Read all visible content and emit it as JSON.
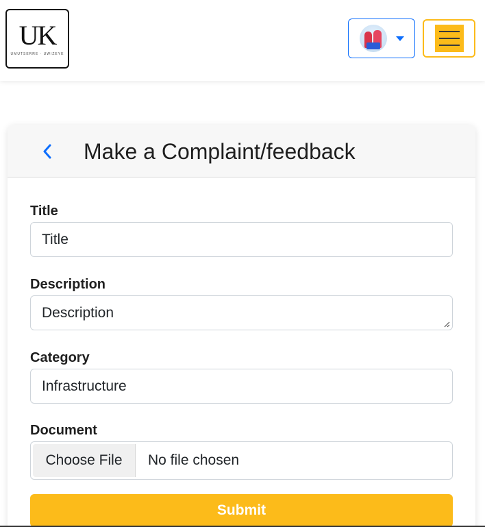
{
  "header": {
    "logo_mark": "UK",
    "logo_tagline": "UMUTSERRE · UWIZEYE",
    "profile_icon": "avatar-photo",
    "dropdown_icon": "caret-down-icon",
    "menu_icon": "hamburger-icon"
  },
  "card": {
    "back_icon": "chevron-left-icon",
    "title": "Make a Complaint/feedback"
  },
  "form": {
    "title_label": "Title",
    "title_placeholder": "Title",
    "description_label": "Description",
    "description_placeholder": "Description",
    "category_label": "Category",
    "category_value": "Infrastructure",
    "document_label": "Document",
    "file_button_label": "Choose File",
    "file_status": "No file chosen",
    "submit_label": "Submit"
  },
  "colors": {
    "accent": "#fcbb1a",
    "primary": "#0d6efd",
    "border": "#ced4da"
  }
}
